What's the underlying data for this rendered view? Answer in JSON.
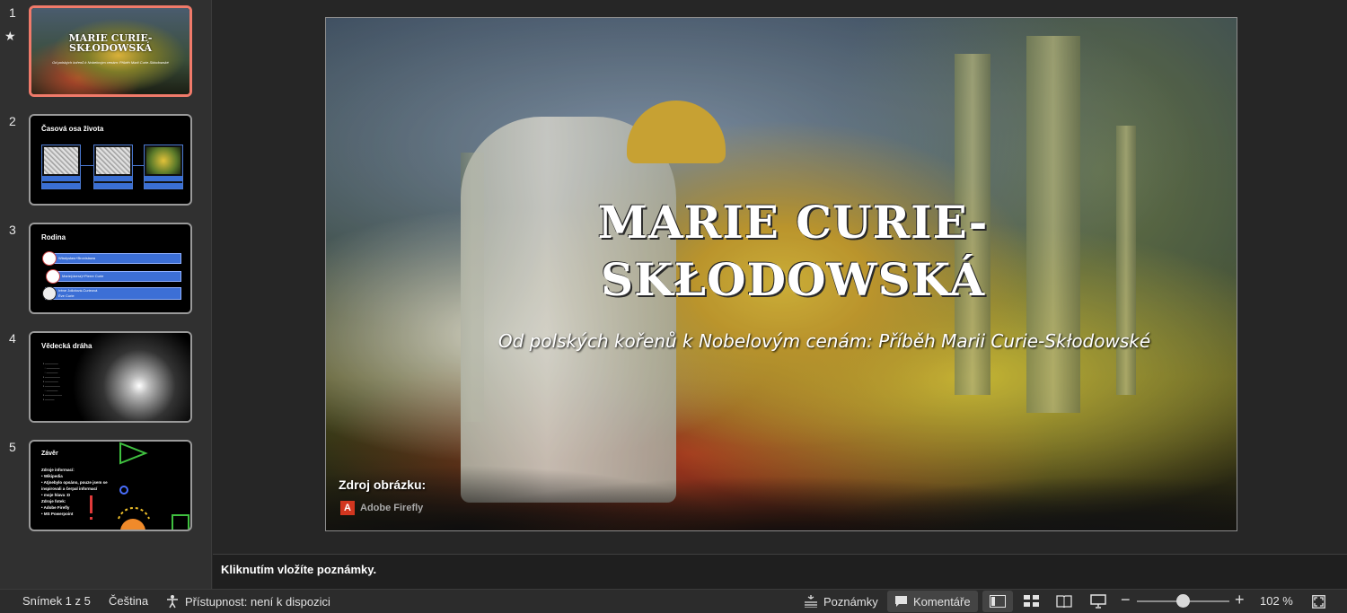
{
  "thumbnails": [
    {
      "number": "1",
      "title_line1": "MARIE CURIE-",
      "title_line2": "SKŁODOWSKÁ",
      "subtitle": "Od polských kořenů k Nobelovým cenám: Příběh Marii Curie-Skłodowské"
    },
    {
      "number": "2",
      "title": "Časová osa života"
    },
    {
      "number": "3",
      "title": "Rodina",
      "rows": [
        "Władysław+Bronisława",
        "Marie(dcera)+Pierre Curie",
        "Irène Joliotová-Curieová\nÈve Curie"
      ]
    },
    {
      "number": "4",
      "title": "Vědecká dráha"
    },
    {
      "number": "5",
      "title": "Závěr",
      "lines": [
        "Zdroje informací:",
        "• Wikipedia",
        "• Atjnebylo opsáno, pouze jsem se inspirovali a čerpal informací",
        "• moje hlava :D",
        "Zdroje fotek:",
        "• Adobe Firefly",
        "• MS Powerpoint"
      ]
    }
  ],
  "slide": {
    "title_line1": "MARIE CURIE-",
    "title_line2": "SKŁODOWSKÁ",
    "subtitle": "Od polských kořenů k Nobelovým cenám: Příběh Marii Curie-Skłodowské",
    "image_source_label": "Zdroj obrázku:",
    "image_source_name": "Adobe Firefly"
  },
  "notes_placeholder": "Kliknutím vložíte poznámky.",
  "status": {
    "slide_counter": "Snímek 1 z 5",
    "language": "Čeština",
    "accessibility": "Přístupnost: není k dispozici",
    "notes_button": "Poznámky",
    "comments_button": "Komentáře",
    "zoom_level": "102 %",
    "zoom_fraction": 0.5
  },
  "colors": {
    "selected_thumb_border": "#f07a6a",
    "accent_blue": "#3c6fd6"
  }
}
